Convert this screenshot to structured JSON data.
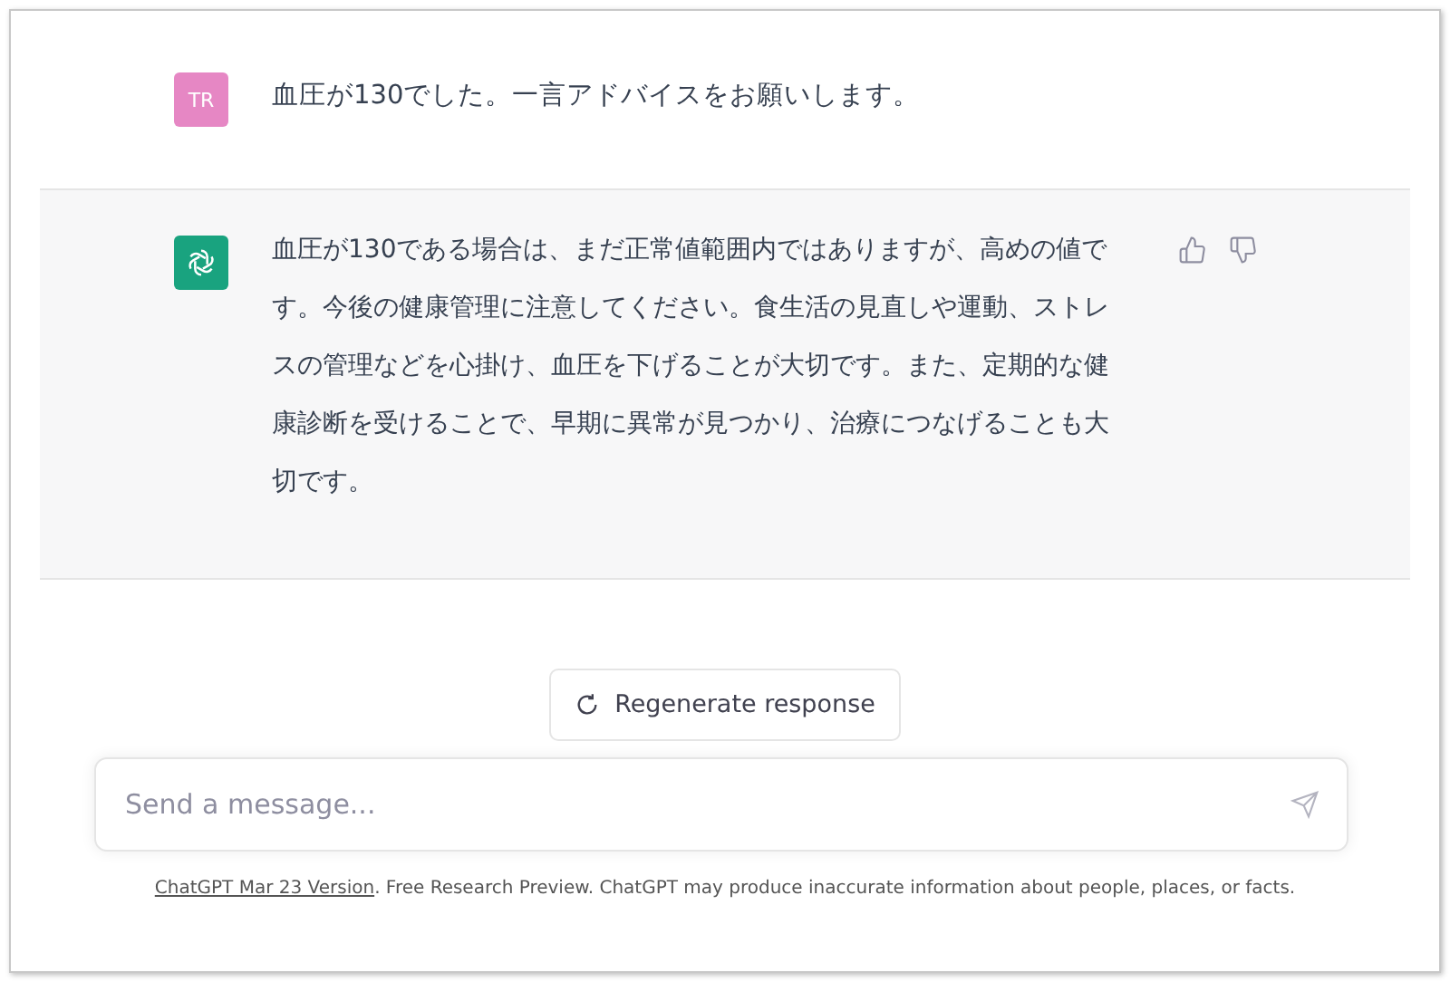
{
  "messages": [
    {
      "kind": "user",
      "avatar": "TR",
      "text": "血圧が130でした。一言アドバイスをお願いします。"
    },
    {
      "kind": "assistant",
      "text": "血圧が130である場合は、まだ正常値範囲内ではありますが、高めの値です。今後の健康管理に注意してください。食生活の見直しや運動、ストレスの管理などを心掛け、血圧を下げることが大切です。また、定期的な健康診断を受けることで、早期に異常が見つかり、治療につなげることも大切です。"
    }
  ],
  "regenerate": {
    "label": "Regenerate response"
  },
  "composer": {
    "placeholder": "Send a message..."
  },
  "footer": {
    "link": "ChatGPT Mar 23 Version",
    "text": ". Free Research Preview. ChatGPT may produce inaccurate information about people, places, or facts."
  }
}
